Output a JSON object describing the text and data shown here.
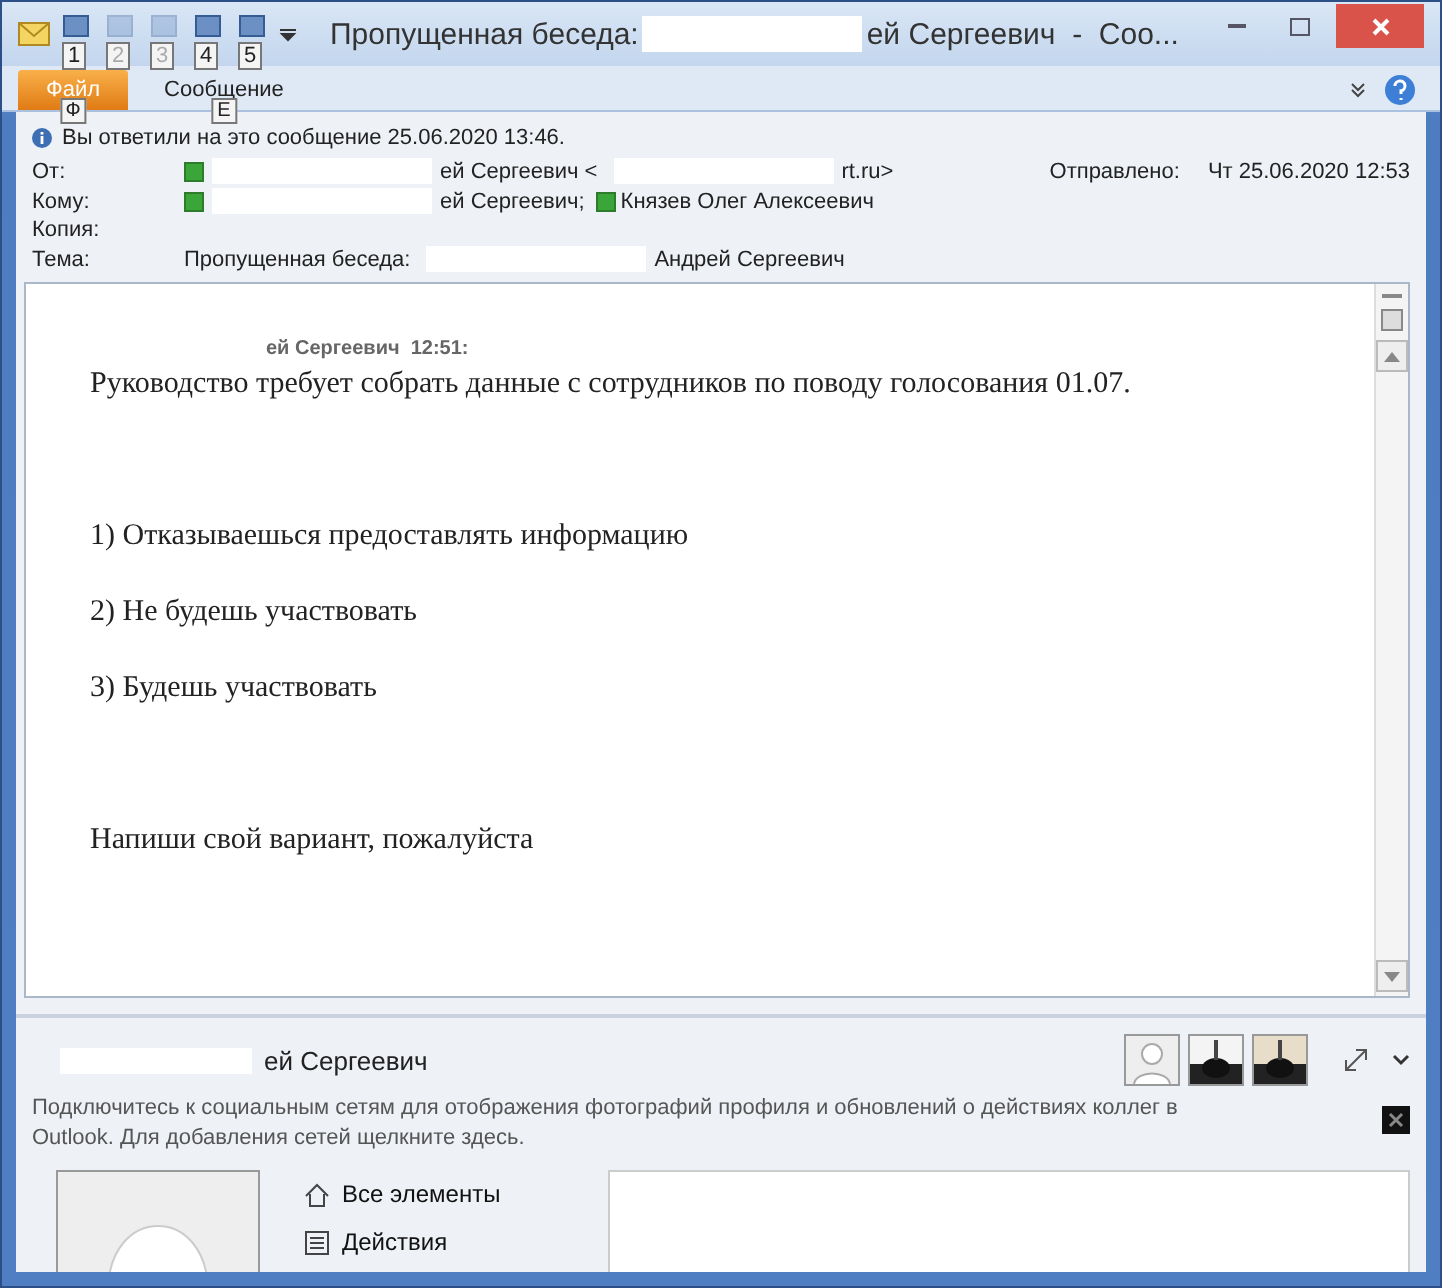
{
  "window": {
    "title_prefix": "Пропущенная беседа:",
    "title_suffix": "ей Сергеевич  -  Соо..."
  },
  "quick_access": [
    {
      "key": "1",
      "disabled": false
    },
    {
      "key": "2",
      "disabled": true
    },
    {
      "key": "3",
      "disabled": true
    },
    {
      "key": "4",
      "disabled": false
    },
    {
      "key": "5",
      "disabled": false
    }
  ],
  "ribbon_tabs": [
    {
      "label": "Файл",
      "key": "Ф",
      "selected": true
    },
    {
      "label": "Сообщение",
      "key": "Е",
      "selected": false
    }
  ],
  "info_bar": "Вы ответили на это сообщение 25.06.2020 13:46.",
  "header": {
    "fields": [
      {
        "label": "От:",
        "segments": [
          {
            "kind": "presence"
          },
          {
            "kind": "redaction"
          },
          {
            "kind": "text",
            "text": "ей Сергеевич <"
          },
          {
            "kind": "redaction"
          },
          {
            "kind": "text",
            "text": "rt.ru>"
          }
        ]
      },
      {
        "label": "Кому:",
        "segments": [
          {
            "kind": "presence"
          },
          {
            "kind": "redaction"
          },
          {
            "kind": "text",
            "text": "ей Сергеевич;"
          },
          {
            "kind": "presence"
          },
          {
            "kind": "text",
            "text": "Князев Олег Алексеевич"
          }
        ]
      },
      {
        "label": "Копия:"
      },
      {
        "label": "Тема:",
        "segments": [
          {
            "kind": "text",
            "text": "Пропущенная беседа:"
          },
          {
            "kind": "redaction"
          },
          {
            "kind": "text",
            "text": "Андрей Сергеевич"
          }
        ]
      }
    ],
    "sent_label": "Отправлено:",
    "sent_value": "Чт 25.06.2020 12:53"
  },
  "message": {
    "author": "ей Сергеевич  12:51:",
    "paragraphs": [
      "Руководство требует собрать данные с сотрудников по поводу голосования 01.07.",
      "1) Отказываешься предоставлять информацию",
      "2) Не будешь участвовать",
      "3) Будешь участвовать",
      "Напиши свой вариант, пожалуйста"
    ]
  },
  "people_pane": {
    "name": "ей Сергеевич",
    "social_note": "Подключитесь к социальным сетям для отображения фотографий профиля и обновлений о действиях коллег в Outlook. Для добавления сетей щелкните здесь.",
    "nav": [
      {
        "kind": "home",
        "label": "Все элементы"
      },
      {
        "kind": "list",
        "label": "Действия"
      }
    ]
  }
}
